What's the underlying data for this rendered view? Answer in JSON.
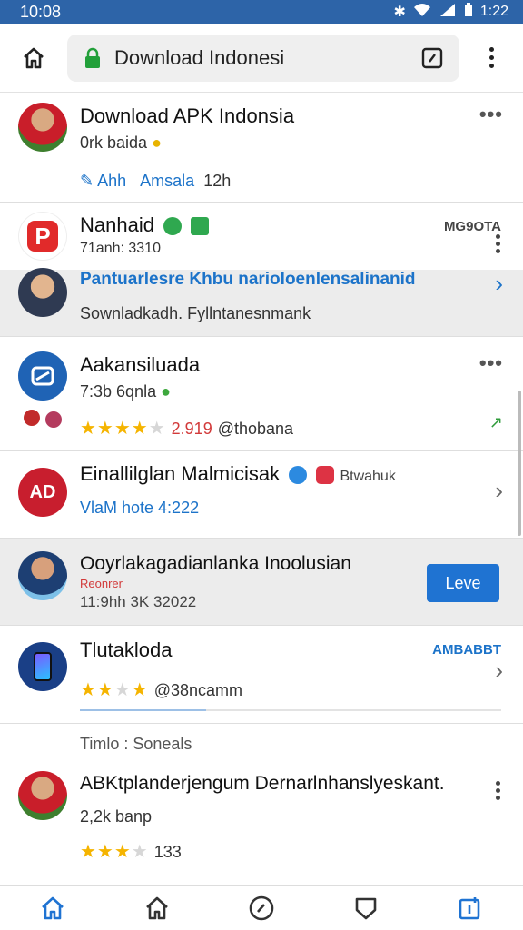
{
  "status_bar": {
    "time": "10:08",
    "battery_time": "1:22"
  },
  "browser": {
    "url": "Download Indonesi"
  },
  "items": [
    {
      "title": "Download APK Indonsia",
      "subtitle": "0rk baida",
      "link1": "Ahh",
      "link2": "Amsala",
      "meta": "12h"
    },
    {
      "title": "Nanhaid",
      "subtitle": "71anh: 3310",
      "tag": "MG9OTA"
    },
    {
      "title": "Pantuarlesre Khbu narioloenlensalinanid",
      "subtitle": "Sownladkadh. Fyllntanesnmank"
    },
    {
      "title": "Aakansiluada",
      "subtitle": "7:3b 6qnla",
      "rating_value": "2.919",
      "rating_handle": "@thobana"
    },
    {
      "title": "Einallilglan Malmicisak",
      "tag": "Btwahuk",
      "link": "VlaM hote 4:222"
    },
    {
      "title": "Ooyrlakagadianlanka Inoolusian",
      "tag_red": "Reonrer",
      "subtitle": "11:9hh 3K 32022",
      "button": "Leve"
    },
    {
      "title": "Tlutakloda",
      "tag": "AMBABBT",
      "rating_handle": "@38ncamm"
    },
    {
      "section": "Timlo : Soneals"
    },
    {
      "title": "ABKtplanderjengum Dernarlnhanslyeskant.",
      "subtitle": "2,2k banp",
      "rating_value": "133"
    }
  ],
  "icons": [
    "home-icon",
    "lock-icon",
    "tabs-icon",
    "more-vert-icon",
    "compass-icon",
    "shield-icon",
    "new-tab-icon"
  ],
  "colors": {
    "accent": "#1f73d2",
    "status_bar": "#2d64a8",
    "star": "#f5b400"
  }
}
